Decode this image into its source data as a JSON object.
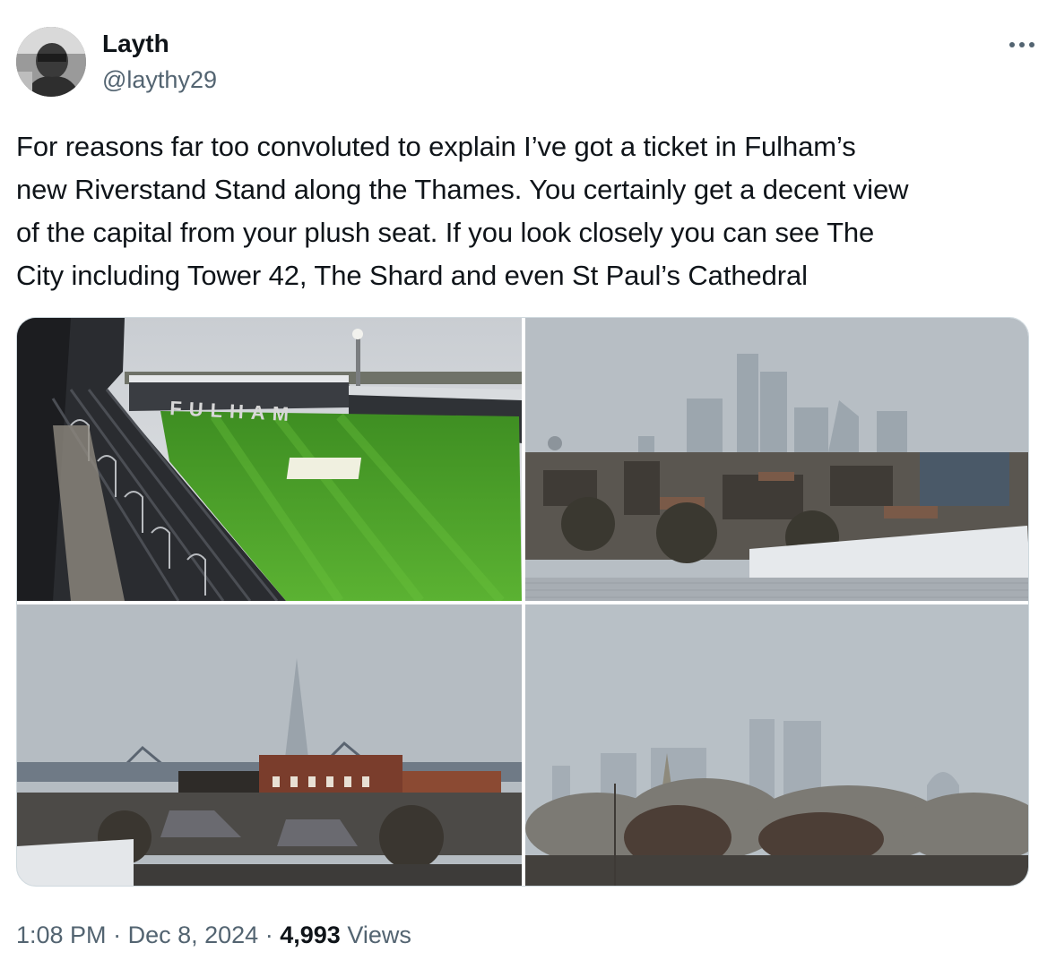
{
  "author": {
    "display_name": "Layth",
    "handle": "@laythy29",
    "avatar_icon": "avatar-photo"
  },
  "more_icon": "more-horizontal-icon",
  "tweet": {
    "text": "For reasons far too convoluted to explain I’ve got a ticket in Fulham’s\nnew Riverstand Stand along the Thames. You certainly get a decent view\nof the capital from your plush seat. If you look closely you can see The\nCity including Tower 42, The Shard and even St Paul’s Cathedral"
  },
  "media": {
    "stadium_sign": "FULHAM",
    "photo_count": 4
  },
  "meta": {
    "time": "1:08 PM",
    "separator": "·",
    "date": "Dec 8, 2024",
    "views_count": "4,993",
    "views_label": "Views"
  },
  "colors": {
    "text_primary": "#0f1419",
    "text_secondary": "#536471",
    "border": "#cfd9de",
    "pitch_green": "#4a9a2a",
    "sky_grey": "#b9c0c6"
  }
}
